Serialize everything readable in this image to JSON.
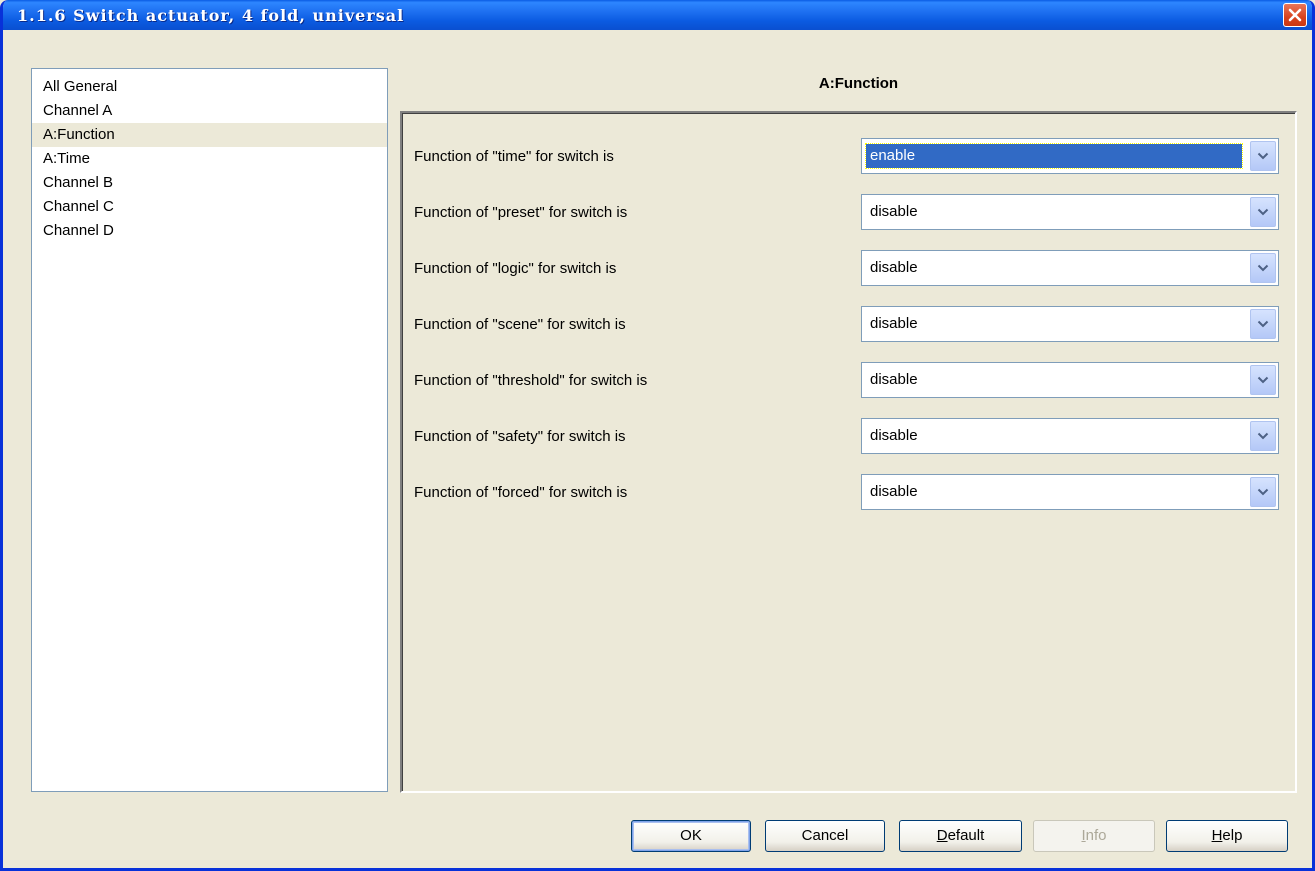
{
  "window": {
    "title": "1.1.6 Switch actuator, 4 fold, universal"
  },
  "sidebar": {
    "items": [
      {
        "label": "All General"
      },
      {
        "label": "Channel A"
      },
      {
        "label": "A:Function"
      },
      {
        "label": "A:Time"
      },
      {
        "label": "Channel B"
      },
      {
        "label": "Channel C"
      },
      {
        "label": "Channel D"
      }
    ],
    "selected": "A:Function"
  },
  "panel": {
    "title": "A:Function",
    "params": [
      {
        "label": "Function of \"time\" for switch is",
        "value": "enable"
      },
      {
        "label": "Function of \"preset\" for switch is",
        "value": "disable"
      },
      {
        "label": "Function of \"logic\" for switch is",
        "value": "disable"
      },
      {
        "label": "Function of \"scene\" for switch is",
        "value": "disable"
      },
      {
        "label": "Function of \"threshold\" for switch is",
        "value": "disable"
      },
      {
        "label": "Function of \"safety\" for switch is",
        "value": "disable"
      },
      {
        "label": "Function of \"forced\" for switch is",
        "value": "disable"
      }
    ]
  },
  "buttons": {
    "ok": "OK",
    "cancel": "Cancel",
    "default_rest": "efault",
    "default_mnemonic": "D",
    "info_rest": "nfo",
    "info_mnemonic": "I",
    "help_rest": "elp",
    "help_mnemonic": "H"
  },
  "colors": {
    "titlebar": "#0a5be3",
    "dialog_bg": "#ece9d8",
    "selection": "#316ac5",
    "close_button": "#d9431e"
  }
}
